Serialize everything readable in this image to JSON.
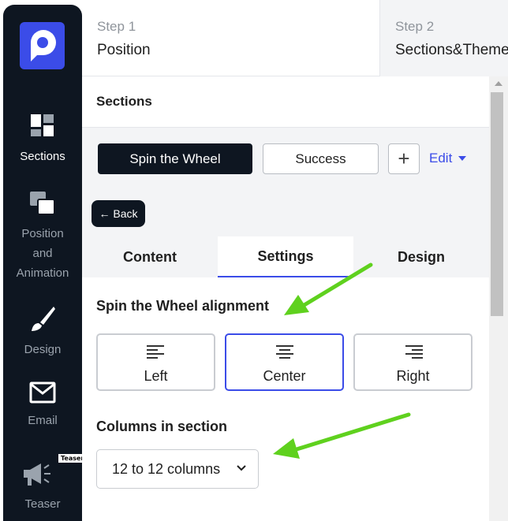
{
  "sidebar": {
    "logo_icon": "brand-logo-icon",
    "items": [
      {
        "label": "Sections",
        "icon": "sections-icon",
        "active": true
      },
      {
        "label": "Position and Animation",
        "line1": "Position",
        "line2": "and",
        "line3": "Animation",
        "icon": "position-icon"
      },
      {
        "label": "Design",
        "icon": "brush-icon"
      },
      {
        "label": "Email",
        "icon": "envelope-icon"
      },
      {
        "label": "Teaser",
        "icon": "megaphone-icon",
        "badge": "Teaser"
      }
    ]
  },
  "steps": [
    {
      "num": "Step 1",
      "name": "Position"
    },
    {
      "num": "Step 2",
      "name": "Sections&Theme"
    }
  ],
  "sections": {
    "title": "Sections",
    "tabs": [
      {
        "label": "Spin the Wheel",
        "active": true
      },
      {
        "label": "Success"
      }
    ],
    "add_label": "+",
    "edit_label": "Edit"
  },
  "back_label": "← Back",
  "subtabs": [
    {
      "label": "Content"
    },
    {
      "label": "Settings",
      "active": true
    },
    {
      "label": "Design"
    }
  ],
  "alignment": {
    "label": "Spin the Wheel alignment",
    "options": [
      {
        "label": "Left",
        "icon": "align-left-icon"
      },
      {
        "label": "Center",
        "icon": "align-center-icon",
        "selected": true
      },
      {
        "label": "Right",
        "icon": "align-right-icon"
      }
    ]
  },
  "columns": {
    "label": "Columns in section",
    "value": "12 to 12 columns"
  },
  "colors": {
    "accent": "#3b4ce8",
    "sidebar_bg": "#0e1621",
    "annotation_arrow": "#5fd11e"
  }
}
